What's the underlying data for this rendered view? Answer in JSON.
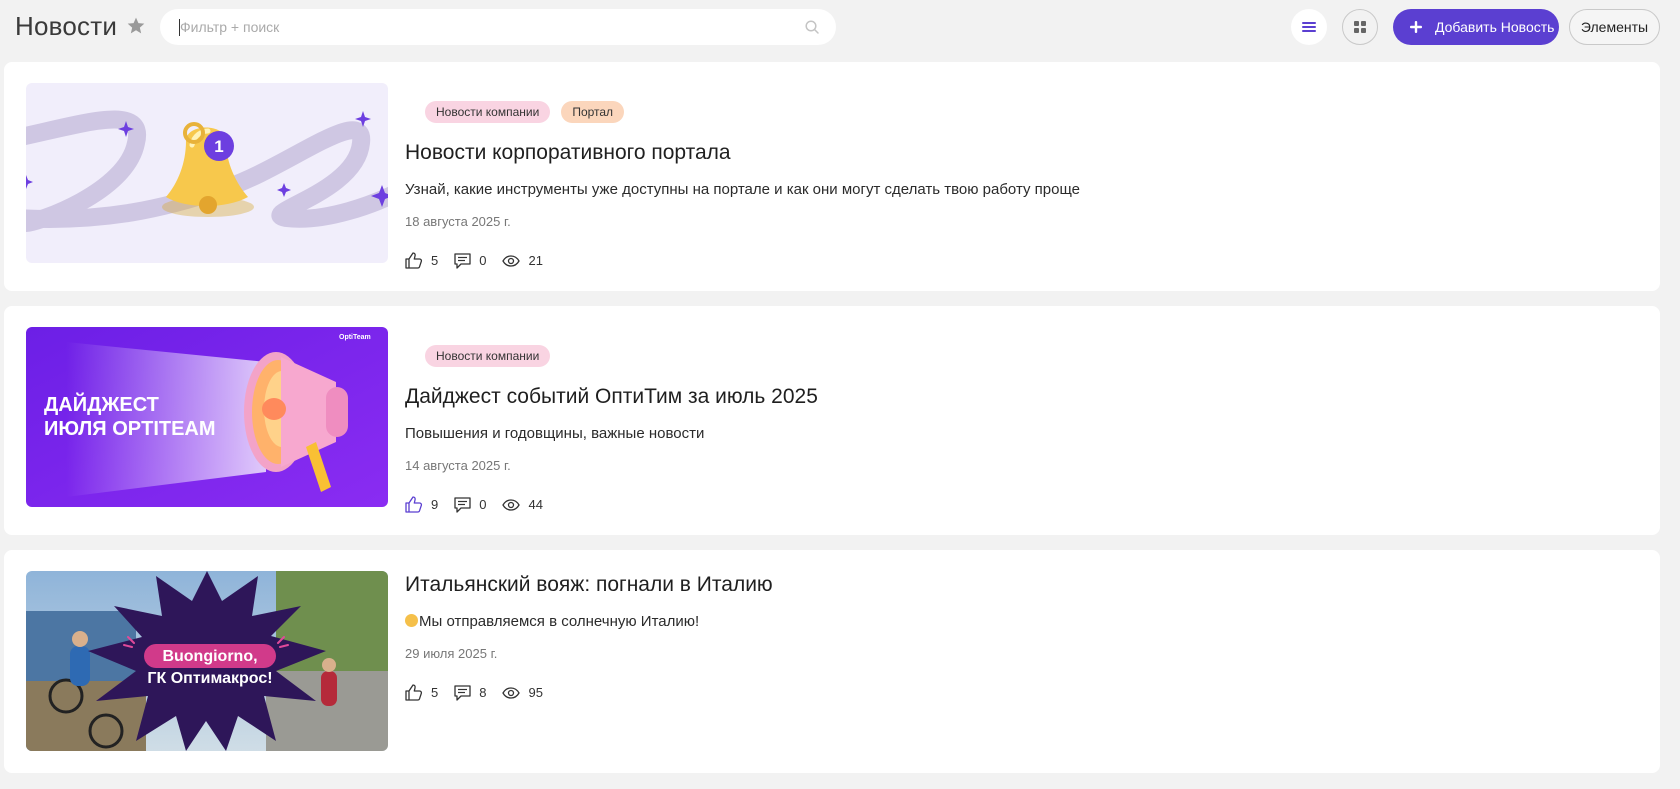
{
  "header": {
    "title": "Новости",
    "search_placeholder": "Фильтр + поиск",
    "add_button_label": "Добавить Новость",
    "elements_button_label": "Элементы"
  },
  "colors": {
    "accent": "#5b3fd1",
    "tag_pink": "#f9d4e2",
    "tag_orange": "#fbd6bc",
    "background": "#f2f2f2"
  },
  "news": [
    {
      "tags": [
        "Новости компании",
        "Портал"
      ],
      "title": "Новости корпоративного портала",
      "description": "Узнай, какие инструменты уже доступны на портале и как они могут сделать твою работу проще",
      "date": "18 августа 2025 г.",
      "likes": "5",
      "comments": "0",
      "views": "21",
      "image_icon": "bell-notification-icon"
    },
    {
      "tags": [
        "Новости компании"
      ],
      "title": "Дайджест событий ОптиТим за июль 2025",
      "description": "Повышения и годовщины, важные новости",
      "date": "14 августа 2025 г.",
      "likes": "9",
      "comments": "0",
      "views": "44",
      "image_text_line1": "ДАЙДЖЕСТ",
      "image_text_line2": "ИЮЛЯ OPTITEAM",
      "image_logo": "OptiTeam",
      "image_icon": "megaphone-icon"
    },
    {
      "tags": [],
      "title": "Итальянский вояж: погнали в Италию",
      "description": "Мы отправляемся в солнечную Италию!",
      "date": "29 июля 2025 г.",
      "likes": "5",
      "comments": "8",
      "views": "95",
      "image_text_line1": "Buongiorno,",
      "image_text_line2": "ГК Оптимакрос!"
    }
  ]
}
